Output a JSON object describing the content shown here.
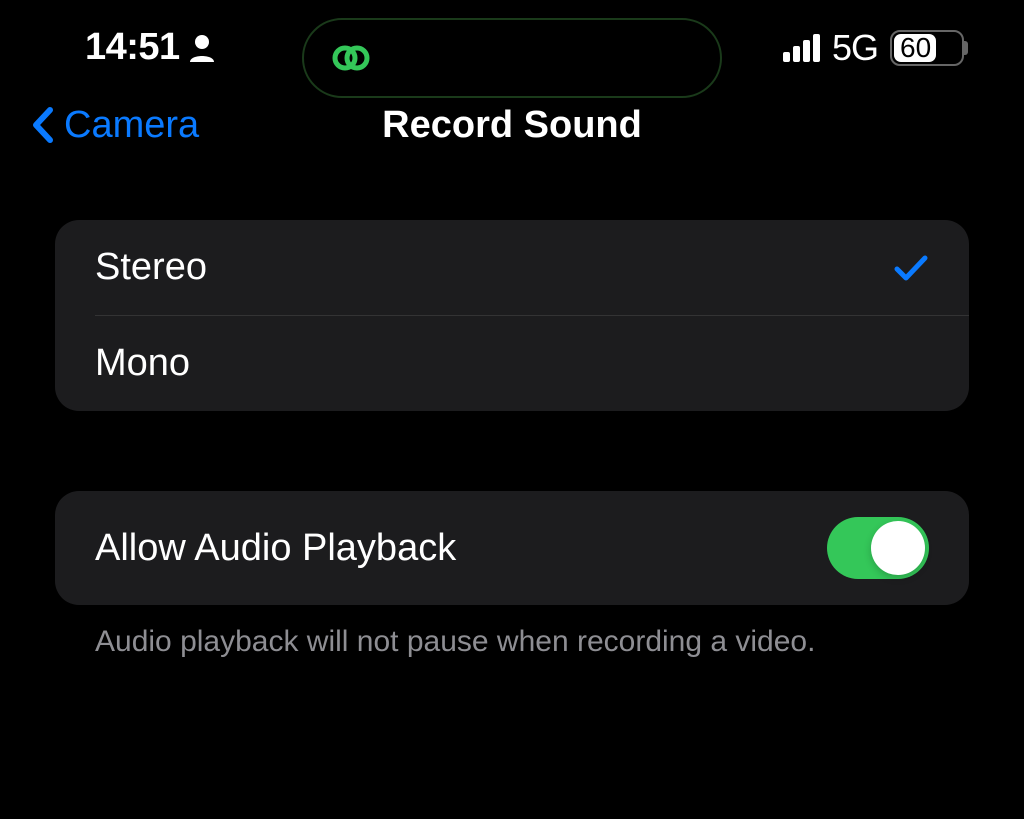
{
  "status": {
    "time": "14:51",
    "network": "5G",
    "battery": "60"
  },
  "nav": {
    "back_label": "Camera",
    "title": "Record Sound"
  },
  "options": {
    "stereo": "Stereo",
    "mono": "Mono"
  },
  "toggle": {
    "label": "Allow Audio Playback",
    "footer": "Audio playback will not pause when recording a video."
  }
}
